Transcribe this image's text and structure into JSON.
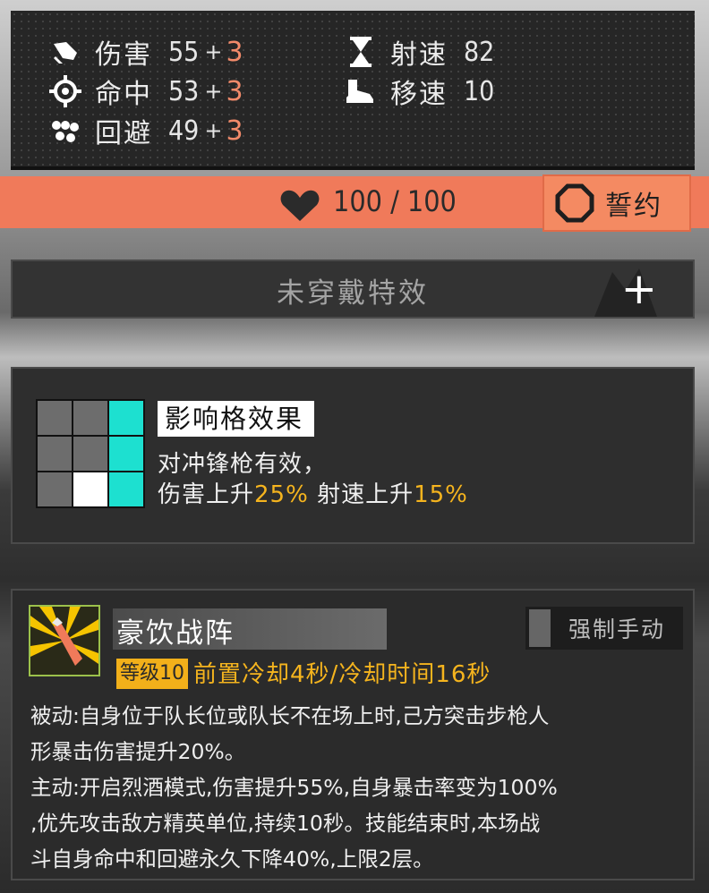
{
  "stats": {
    "damage": {
      "name": "伤害",
      "base": "55",
      "plus": "+",
      "bonus": "3"
    },
    "accuracy": {
      "name": "命中",
      "base": "53",
      "plus": "+",
      "bonus": "3"
    },
    "evasion": {
      "name": "回避",
      "base": "49",
      "plus": "+",
      "bonus": "3"
    },
    "rate_of_fire": {
      "name": "射速",
      "value": "82"
    },
    "movement": {
      "name": "移速",
      "value": "10"
    }
  },
  "hp": {
    "current": 100,
    "max": 100,
    "text": "100 / 100"
  },
  "oath": {
    "label": "誓约"
  },
  "special_effect": {
    "text": "未穿戴特效",
    "plus": "+"
  },
  "tile_effect": {
    "title": "影响格效果",
    "grid": [
      [
        "normal",
        "normal",
        "buff"
      ],
      [
        "normal",
        "normal",
        "buff"
      ],
      [
        "normal",
        "self",
        "buff"
      ]
    ],
    "line1": "对冲锋枪有效，",
    "line2_a": "伤害上升",
    "line2_b": "25%",
    "line2_c": " 射速上升",
    "line2_d": "15%"
  },
  "skill": {
    "name": "豪饮战阵",
    "manual_label": "强制手动",
    "level": "等级10",
    "cooldown": "前置冷却4秒/冷却时间16秒",
    "desc": [
      "被动:自身位于队长位或队长不在场上时,己方突击步枪人",
      "形暴击伤害提升20%。",
      "主动:开启烈酒模式,伤害提升55%,自身暴击率变为100%",
      ",优先攻击敌方精英单位,持续10秒。技能结束时,本场战",
      "斗自身命中和回避永久下降40%,上限2层。"
    ]
  },
  "colors": {
    "accent_orange": "#f07a5a",
    "buff_cyan": "#1de0d0",
    "highlight_yellow": "#f5b41e",
    "bonus_pink": "#f28a6a"
  }
}
